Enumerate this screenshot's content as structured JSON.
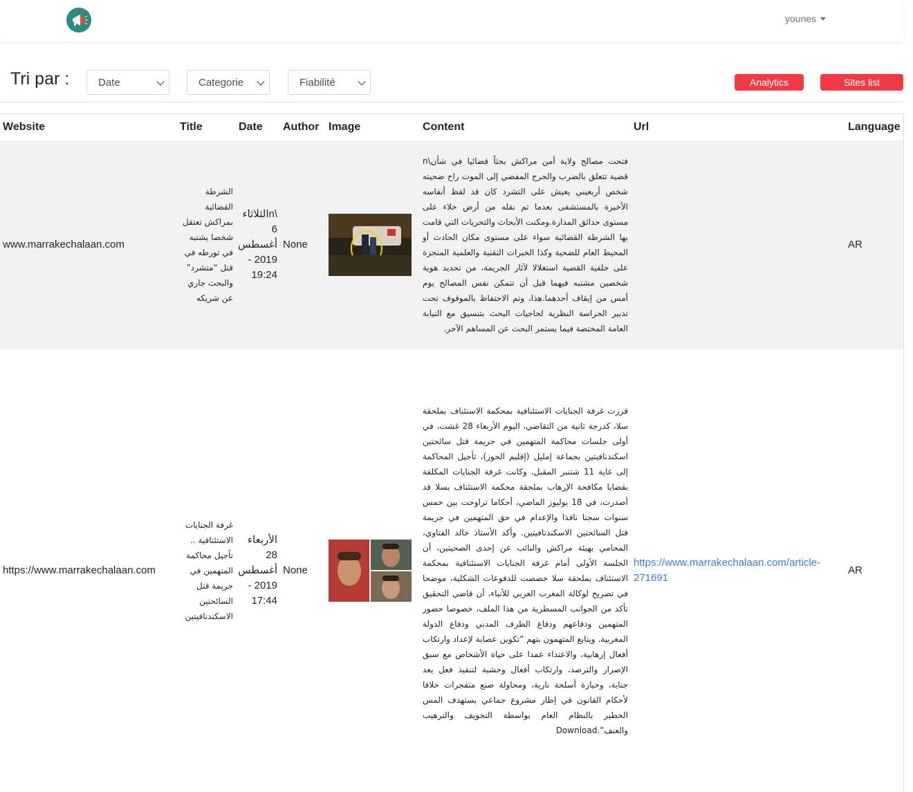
{
  "navbar": {
    "logo_icon": "megaphone-icon",
    "user": "younes"
  },
  "sortbar": {
    "label": "Tri par :",
    "selects": [
      {
        "selected": "Date"
      },
      {
        "selected": "Categorie"
      },
      {
        "selected": "Fiabilité"
      }
    ],
    "buttons": {
      "analytics": "Analytics",
      "sites_list": "Sites list"
    }
  },
  "table": {
    "headers": {
      "website": "Website",
      "title": "Title",
      "date": "Date",
      "author": "Author",
      "image": "Image",
      "content": "Content",
      "url": "Url",
      "language": "Language"
    },
    "rows": [
      {
        "website": "www.marrakechalaan.com",
        "title": "الشرطة القضائية بمراكش تعتقل شخصا يشتبه في تورطه في قتل “متشرد” والبحث جاري عن شريكه",
        "date": "\\nالثلاثاء 6 أغسطس 2019 - 19:24",
        "author": "None",
        "image": "night-crime-scene-photo",
        "content": "فتحت مصالح ولاية أمن مراكش بحثاً قضائيا في شأن\\n قضية تتعلق بالضرب والجرح المفضي إلى الموت راح ضحيته شخص أربعيني يعيش على التشرد كان قد لفظ أنفاسه الأخيرة بالمستشفى بعدما تم نقله من أرض خلاء على مستوى حدائق المدارة.ومكنت الأبحاث والتحريات التي قامت بها الشرطة القضائية سواء على مستوى مكان الحادث أو المحيط العام للضحية وكذا الخبرات التقنية والعلمية المنجزة على خلفية القضية استغلالا لآثار الجريمة، من تحديد هوية شخصين مشتبه فيهما قبل أن تتمكن نفس المصالح يوم أمس من إيقاف أحدهما.هذا، وتم الاحتفاظ بالموقوف تحت تدبير الحراسة النظرية لحاجيات البحث بتنسيق مع النيابة العامة المختصة فيما يستمر البحث عن المساهم الآخر.",
        "url": "",
        "language": "AR"
      },
      {
        "website": "https://www.marrakechalaan.com",
        "title": "غرفة الجنايات الاستئنافية .. تأجيل محاكمة المتهمين في جريمة قتل السائحتين الاسكندنافيتين",
        "date": "الأربعاء 28 أغسطس 2019 - 17:44",
        "author": "None",
        "image": "suspects-collage-photo",
        "content": "قررت غرفة الجنايات الاستئنافية بمحكمة الاستئناف بملحقة سلا، كدرجة ثانية من التقاضي، اليوم الأربعاء 28 غشت، في أولى جلسات محاكمة المتهمين في جريمة قتل سائحتين اسكندنافيتين بجماعة إمليل (إقليم الحوز)، تأجيل المحاكمة إلى غاية 11 شتنبر المقبل. وكانت غرفة الجنايات المكلفة بقضايا مكافحة الإرهاب بملحقة محكمة الاستئناف بسلا قد أصدرت، في 18 يوليوز الماضي، أحكاما تراوحت بين خمس سنوات سجنا نافذا والإعدام في حق المتهمين في جريمة قتل السائحتين الاسكندنافيتين. وأكد الأستاذ خالد الفتاوي، المحامي بهيئة مراكش والنائب عن إحدى الضحيتين، أن الجلسة الأولى أمام غرفة الجنايات الاستئنافية بمحكمة الاستئناف بملحقة سلا خصصت للدفوعات الشكلية، موضحا في تصريح لوكالة المغرب العربي للأنباء، أن قاضي التحقيق تأكد من الجوانب المسطرية من هذا الملف، خصوصا حضور المتهمين ودفاعهم ودفاع الطرف المدني ودفاع الدولة المغربية. ويتابع المتهمون بتهم “تكوين عصابة لإعداد وارتكاب أفعال إرهابية، والاعتداء عمدا على حياة الأشخاص مع سبق الإصرار والترصد، وارتكاب أفعال وحشية لتنفيذ فعل يعد جناية، وحيازة أسلحة نارية، ومحاولة صنع متفجرات خلافا لأحكام القانون في إطار مشروع جماعي يستهدف المس الخطير بالنظام العام بواسطة التخويف والترهيب والعنف”.Download",
        "url": "https://www.marrakechalaan.com/article-271691",
        "language": "AR"
      }
    ]
  }
}
